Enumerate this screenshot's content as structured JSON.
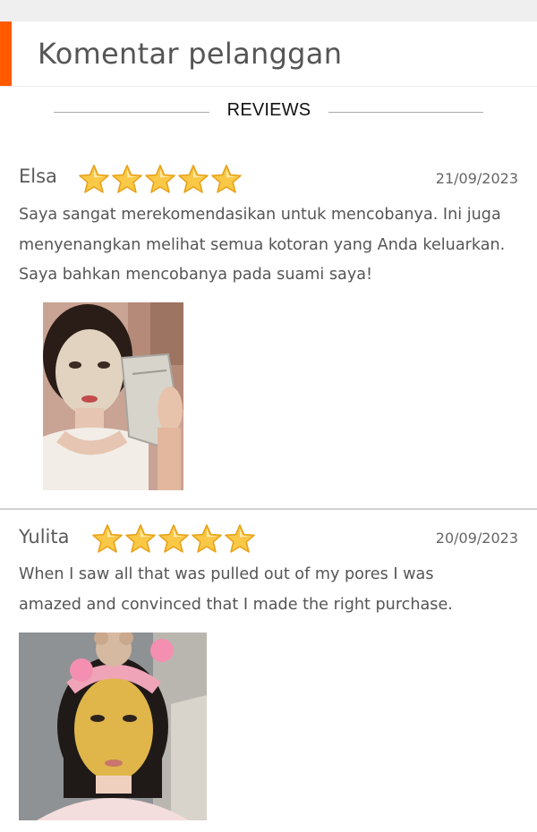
{
  "header": {
    "title": "Komentar pelanggan"
  },
  "divider": {
    "label": "REVIEWS"
  },
  "colors": {
    "accent": "#ff5a00",
    "star_fill": "#f9c846",
    "star_stroke": "#e8a21a"
  },
  "reviews": [
    {
      "name": "Elsa",
      "rating": 5,
      "date": "21/09/2023",
      "lines": [
        "Saya sangat merekomendasikan untuk mencobanya. Ini juga",
        "menyenangkan melihat semua kotoran yang Anda keluarkan.",
        "Saya bahkan mencobanya pada suami saya!"
      ],
      "photo_icon": "customer-photo-clay-mask"
    },
    {
      "name": "Yulita",
      "rating": 5,
      "date": "20/09/2023",
      "lines": [
        "When I saw all that was pulled out of my pores I was",
        "amazed and convinced that I made the right purchase."
      ],
      "photo_icon": "customer-photo-gold-mask"
    }
  ]
}
